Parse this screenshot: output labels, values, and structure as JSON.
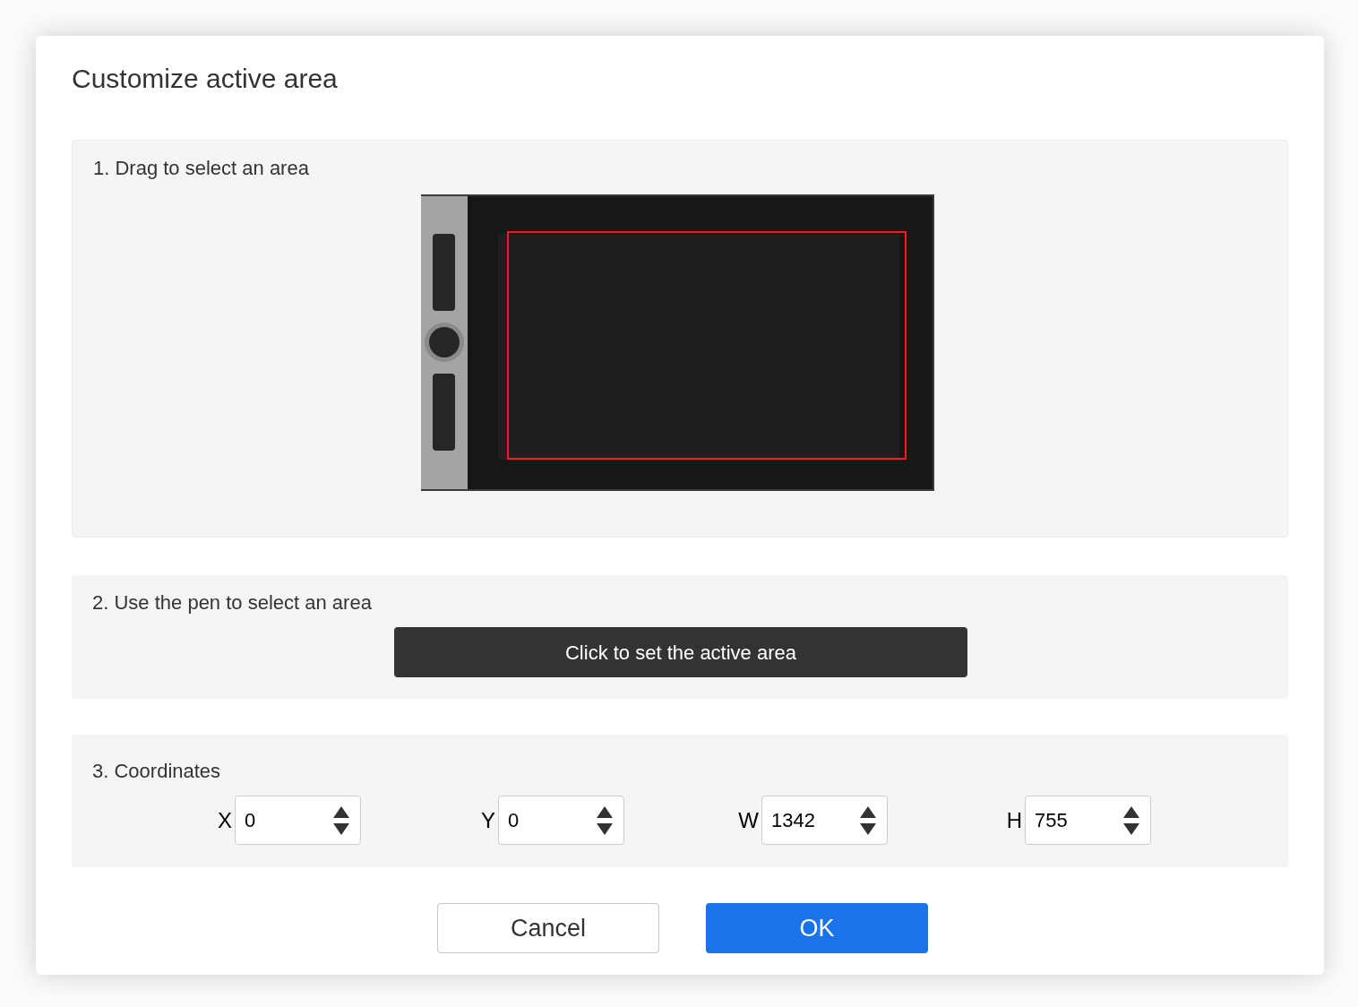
{
  "dialog": {
    "title": "Customize active area"
  },
  "drag_section": {
    "heading": "1. Drag to select an area"
  },
  "pen_section": {
    "heading": "2. Use the pen to select an area",
    "button": "Click to set the active area"
  },
  "coordinates_section": {
    "heading": "3. Coordinates",
    "fields": [
      {
        "label": "X",
        "value": "0"
      },
      {
        "label": "Y",
        "value": "0"
      },
      {
        "label": "W",
        "value": "1342"
      },
      {
        "label": "H",
        "value": "755"
      }
    ]
  },
  "buttons": [
    {
      "label": "Cancel",
      "kind": "secondary"
    },
    {
      "label": "OK",
      "kind": "primary"
    }
  ]
}
